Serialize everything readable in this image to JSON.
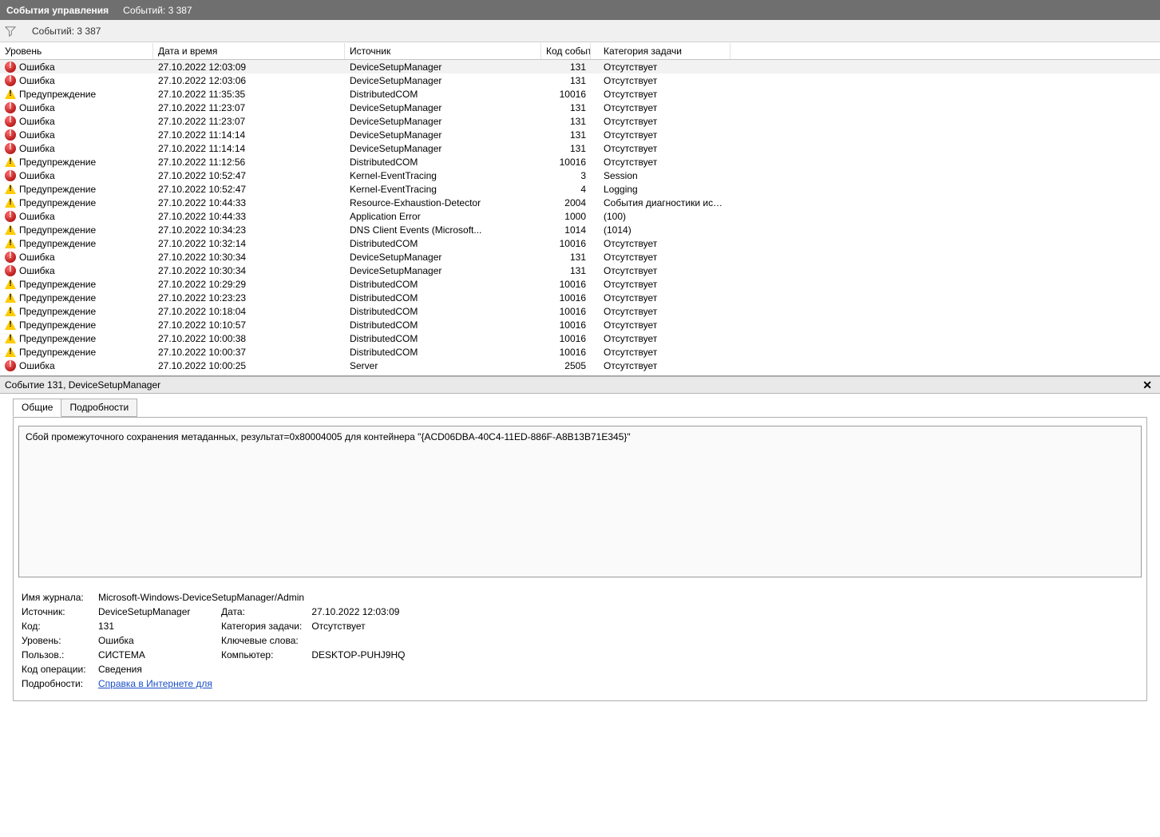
{
  "window": {
    "title": "События управления",
    "count_text": "Событий: 3 387"
  },
  "toolbar": {
    "count_text": "Событий: 3 387"
  },
  "columns": {
    "level": "Уровень",
    "datetime": "Дата и время",
    "source": "Источник",
    "code": "Код события",
    "task": "Категория задачи"
  },
  "levels": {
    "error": "Ошибка",
    "warn": "Предупреждение"
  },
  "rows": [
    {
      "sel": true,
      "lvl": "error",
      "dt": "27.10.2022 12:03:09",
      "src": "DeviceSetupManager",
      "code": "131",
      "task": "Отсутствует"
    },
    {
      "sel": false,
      "lvl": "error",
      "dt": "27.10.2022 12:03:06",
      "src": "DeviceSetupManager",
      "code": "131",
      "task": "Отсутствует"
    },
    {
      "sel": false,
      "lvl": "warn",
      "dt": "27.10.2022 11:35:35",
      "src": "DistributedCOM",
      "code": "10016",
      "task": "Отсутствует"
    },
    {
      "sel": false,
      "lvl": "error",
      "dt": "27.10.2022 11:23:07",
      "src": "DeviceSetupManager",
      "code": "131",
      "task": "Отсутствует"
    },
    {
      "sel": false,
      "lvl": "error",
      "dt": "27.10.2022 11:23:07",
      "src": "DeviceSetupManager",
      "code": "131",
      "task": "Отсутствует"
    },
    {
      "sel": false,
      "lvl": "error",
      "dt": "27.10.2022 11:14:14",
      "src": "DeviceSetupManager",
      "code": "131",
      "task": "Отсутствует"
    },
    {
      "sel": false,
      "lvl": "error",
      "dt": "27.10.2022 11:14:14",
      "src": "DeviceSetupManager",
      "code": "131",
      "task": "Отсутствует"
    },
    {
      "sel": false,
      "lvl": "warn",
      "dt": "27.10.2022 11:12:56",
      "src": "DistributedCOM",
      "code": "10016",
      "task": "Отсутствует"
    },
    {
      "sel": false,
      "lvl": "error",
      "dt": "27.10.2022 10:52:47",
      "src": "Kernel-EventTracing",
      "code": "3",
      "task": "Session"
    },
    {
      "sel": false,
      "lvl": "warn",
      "dt": "27.10.2022 10:52:47",
      "src": "Kernel-EventTracing",
      "code": "4",
      "task": "Logging"
    },
    {
      "sel": false,
      "lvl": "warn",
      "dt": "27.10.2022 10:44:33",
      "src": "Resource-Exhaustion-Detector",
      "code": "2004",
      "task": "События диагностики исчер..."
    },
    {
      "sel": false,
      "lvl": "error",
      "dt": "27.10.2022 10:44:33",
      "src": "Application Error",
      "code": "1000",
      "task": "(100)"
    },
    {
      "sel": false,
      "lvl": "warn",
      "dt": "27.10.2022 10:34:23",
      "src": "DNS Client Events (Microsoft...",
      "code": "1014",
      "task": "(1014)"
    },
    {
      "sel": false,
      "lvl": "warn",
      "dt": "27.10.2022 10:32:14",
      "src": "DistributedCOM",
      "code": "10016",
      "task": "Отсутствует"
    },
    {
      "sel": false,
      "lvl": "error",
      "dt": "27.10.2022 10:30:34",
      "src": "DeviceSetupManager",
      "code": "131",
      "task": "Отсутствует"
    },
    {
      "sel": false,
      "lvl": "error",
      "dt": "27.10.2022 10:30:34",
      "src": "DeviceSetupManager",
      "code": "131",
      "task": "Отсутствует"
    },
    {
      "sel": false,
      "lvl": "warn",
      "dt": "27.10.2022 10:29:29",
      "src": "DistributedCOM",
      "code": "10016",
      "task": "Отсутствует"
    },
    {
      "sel": false,
      "lvl": "warn",
      "dt": "27.10.2022 10:23:23",
      "src": "DistributedCOM",
      "code": "10016",
      "task": "Отсутствует"
    },
    {
      "sel": false,
      "lvl": "warn",
      "dt": "27.10.2022 10:18:04",
      "src": "DistributedCOM",
      "code": "10016",
      "task": "Отсутствует"
    },
    {
      "sel": false,
      "lvl": "warn",
      "dt": "27.10.2022 10:10:57",
      "src": "DistributedCOM",
      "code": "10016",
      "task": "Отсутствует"
    },
    {
      "sel": false,
      "lvl": "warn",
      "dt": "27.10.2022 10:00:38",
      "src": "DistributedCOM",
      "code": "10016",
      "task": "Отсутствует"
    },
    {
      "sel": false,
      "lvl": "warn",
      "dt": "27.10.2022 10:00:37",
      "src": "DistributedCOM",
      "code": "10016",
      "task": "Отсутствует"
    },
    {
      "sel": false,
      "lvl": "error",
      "dt": "27.10.2022 10:00:25",
      "src": "Server",
      "code": "2505",
      "task": "Отсутствует"
    }
  ],
  "details": {
    "header": "Событие 131, DeviceSetupManager",
    "tabs": {
      "general": "Общие",
      "details": "Подробности"
    },
    "message": "Сбой промежуточного сохранения метаданных, результат=0x80004005 для контейнера \"{ACD06DBA-40C4-11ED-886F-A8B13B71E345}\"",
    "labels": {
      "log_name": "Имя журнала:",
      "source": "Источник:",
      "code": "Код:",
      "level": "Уровень:",
      "user": "Пользов.:",
      "opcode": "Код операции:",
      "more": "Подробности:",
      "date": "Дата:",
      "task": "Категория задачи:",
      "keywords": "Ключевые слова:",
      "computer": "Компьютер:"
    },
    "values": {
      "log_name": "Microsoft-Windows-DeviceSetupManager/Admin",
      "source": "DeviceSetupManager",
      "date": "27.10.2022 12:03:09",
      "code": "131",
      "task": "Отсутствует",
      "level": "Ошибка",
      "keywords": "",
      "user": "СИСТЕМА",
      "computer": "DESKTOP-PUHJ9HQ",
      "opcode": "Сведения",
      "more_link": "Справка в Интернете для "
    }
  }
}
